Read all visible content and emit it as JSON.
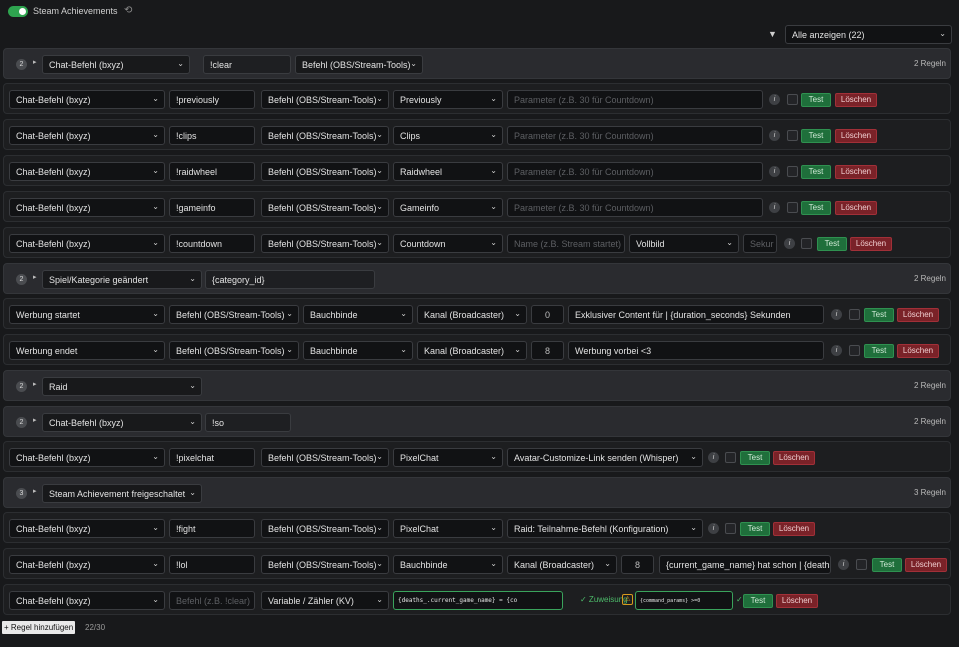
{
  "header": {
    "title": "Steam Achievements",
    "refresh_icon": "⟲",
    "filter_icon": "▼",
    "filter_value": "Alle anzeigen (22)"
  },
  "rows": [
    {
      "group": true,
      "badge": "2",
      "arrow": "▸",
      "trigger": "Chat-Befehl (bxyz)",
      "value": "!clear",
      "action": "Befehl (OBS/Stream-Tools)",
      "count": "2 Regeln"
    },
    {
      "trigger": "Chat-Befehl (bxyz)",
      "value": "!previously",
      "action": "Befehl (OBS/Stream-Tools)",
      "target": "Previously",
      "param_placeholder": "Parameter (z.B. 30 für Countdown)",
      "test": "Test",
      "delete": "Löschen"
    },
    {
      "trigger": "Chat-Befehl (bxyz)",
      "value": "!clips",
      "action": "Befehl (OBS/Stream-Tools)",
      "target": "Clips",
      "param_placeholder": "Parameter (z.B. 30 für Countdown)",
      "test": "Test",
      "delete": "Löschen"
    },
    {
      "trigger": "Chat-Befehl (bxyz)",
      "value": "!raidwheel",
      "action": "Befehl (OBS/Stream-Tools)",
      "target": "Raidwheel",
      "param_placeholder": "Parameter (z.B. 30 für Countdown)",
      "test": "Test",
      "delete": "Löschen"
    },
    {
      "trigger": "Chat-Befehl (bxyz)",
      "value": "!gameinfo",
      "action": "Befehl (OBS/Stream-Tools)",
      "target": "Gameinfo",
      "param_placeholder": "Parameter (z.B. 30 für Countdown)",
      "test": "Test",
      "delete": "Löschen"
    },
    {
      "trigger": "Chat-Befehl (bxyz)",
      "value": "!countdown",
      "action": "Befehl (OBS/Stream-Tools)",
      "target": "Countdown",
      "name_placeholder": "Name (z.B. Stream startet)",
      "mode": "Vollbild",
      "seconds_placeholder": "Sekur",
      "test": "Test",
      "delete": "Löschen"
    },
    {
      "group": true,
      "badge": "2",
      "arrow": "▸",
      "trigger": "Spiel/Kategorie geändert",
      "value": "{category_id}",
      "count": "2 Regeln"
    },
    {
      "trigger": "Werbung startet",
      "action": "Befehl (OBS/Stream-Tools)",
      "target": "Bauchbinde",
      "channel": "Kanal (Broadcaster)",
      "number": "0",
      "text": "Exklusiver Content für | {duration_seconds} Sekunden",
      "test": "Test",
      "delete": "Löschen"
    },
    {
      "trigger": "Werbung endet",
      "action": "Befehl (OBS/Stream-Tools)",
      "target": "Bauchbinde",
      "channel": "Kanal (Broadcaster)",
      "number": "8",
      "text": "Werbung vorbei <3",
      "test": "Test",
      "delete": "Löschen"
    },
    {
      "group": true,
      "badge": "2",
      "arrow": "▸",
      "trigger": "Raid",
      "count": "2 Regeln"
    },
    {
      "group": true,
      "badge": "2",
      "arrow": "▸",
      "trigger": "Chat-Befehl (bxyz)",
      "value": "!so",
      "count": "2 Regeln"
    },
    {
      "trigger": "Chat-Befehl (bxyz)",
      "value": "!pixelchat",
      "action": "Befehl (OBS/Stream-Tools)",
      "target": "PixelChat",
      "extra": "Avatar-Customize-Link senden (Whisper)",
      "test": "Test",
      "delete": "Löschen"
    },
    {
      "group": true,
      "badge": "3",
      "arrow": "▸",
      "trigger": "Steam Achievement freigeschaltet",
      "count": "3 Regeln"
    },
    {
      "trigger": "Chat-Befehl (bxyz)",
      "value": "!fight",
      "action": "Befehl (OBS/Stream-Tools)",
      "target": "PixelChat",
      "extra": "Raid: Teilnahme-Befehl (Konfiguration)",
      "test": "Test",
      "delete": "Löschen"
    },
    {
      "trigger": "Chat-Befehl (bxyz)",
      "value": "!lol",
      "action": "Befehl (OBS/Stream-Tools)",
      "target": "Bauchbinde",
      "channel": "Kanal (Broadcaster)",
      "number": "8",
      "text": "{current_game_name} hat schon | {deaths",
      "test": "Test",
      "delete": "Löschen"
    },
    {
      "trigger": "Chat-Befehl (bxyz)",
      "value_placeholder": "Befehl (z.B. !clear)",
      "action": "Variable / Zähler (KV)",
      "formula": "{deaths_.current_game_name} = {co",
      "assign": "✓ Zuweisung",
      "condition": "{command_params} >=0",
      "check_mark": "✓",
      "test": "Test",
      "delete": "Löschen"
    }
  ],
  "footer": {
    "add_button": "+ Regel hinzufügen",
    "counter": "22/30"
  },
  "colors": {
    "accent": "#2ea44f",
    "test": "#1f6f3b",
    "delete": "#7a2228",
    "background": "#18191b"
  }
}
